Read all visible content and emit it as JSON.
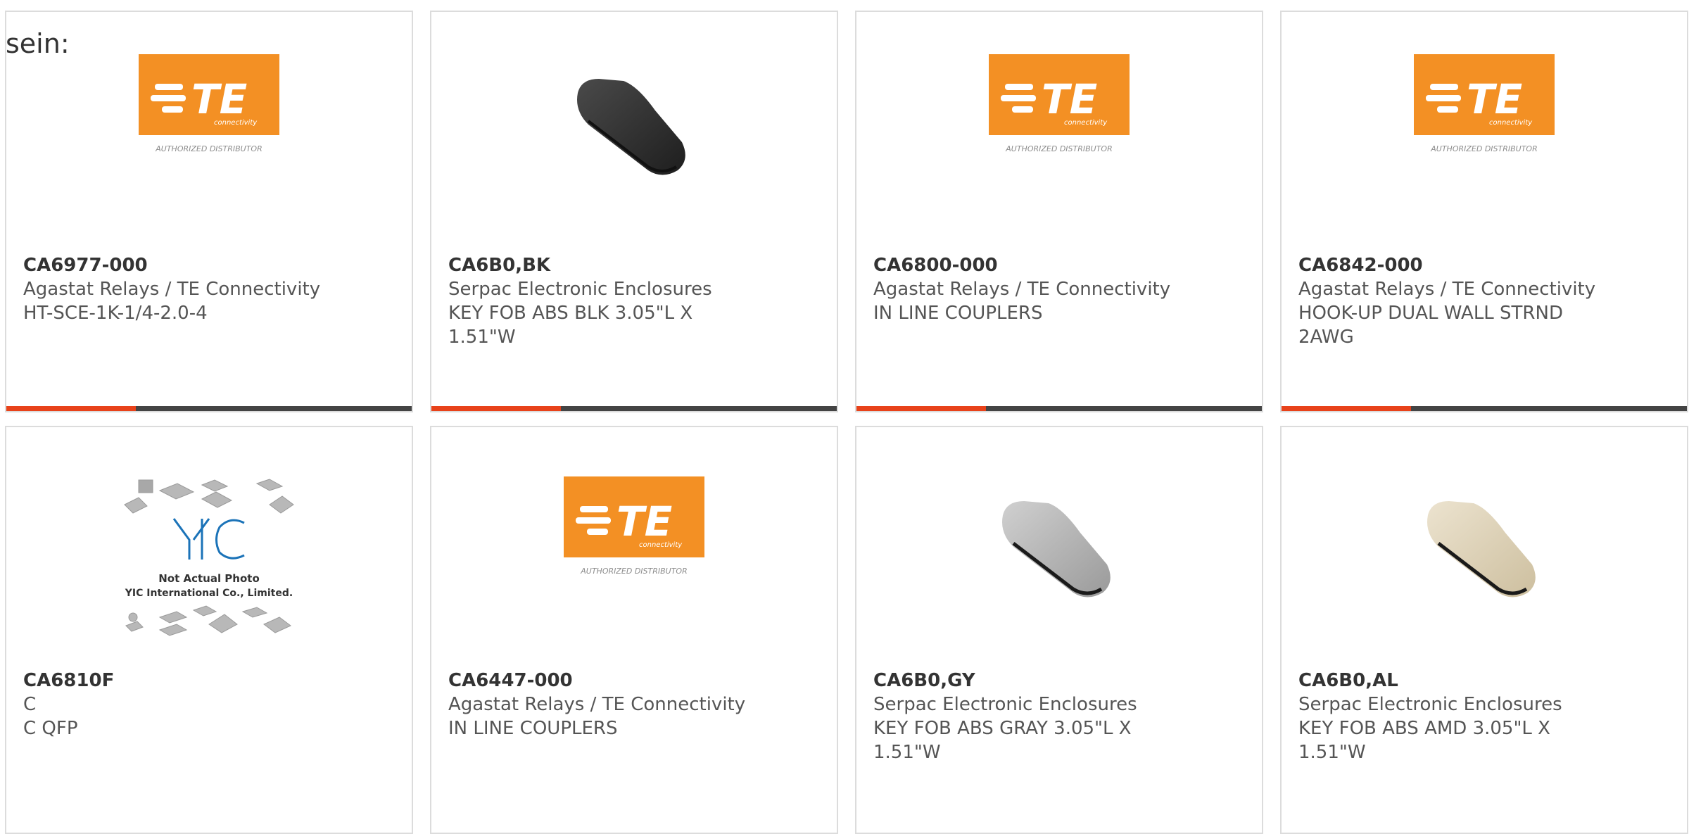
{
  "intro_text": "sein:",
  "colors": {
    "accent": "#e8421a",
    "bar": "#444444",
    "te_orange": "#f39024"
  },
  "products": [
    {
      "part": "CA6977-000",
      "maker": "Agastat Relays / TE Connectivity",
      "desc": "HT-SCE-1K-1/4-2.0-4",
      "image": "te-logo"
    },
    {
      "part": "CA6B0,BK",
      "maker": "Serpac Electronic Enclosures",
      "desc": "KEY FOB ABS BLK 3.05\"L X 1.51\"W",
      "image": "key-fob-black"
    },
    {
      "part": "CA6800-000",
      "maker": "Agastat Relays / TE Connectivity",
      "desc": "IN LINE COUPLERS",
      "image": "te-logo"
    },
    {
      "part": "CA6842-000",
      "maker": "Agastat Relays / TE Connectivity",
      "desc": "HOOK-UP DUAL WALL STRND 2AWG",
      "image": "te-logo"
    },
    {
      "part": "CA6810F",
      "maker": "C",
      "desc": "C QFP",
      "image": "yic-placeholder"
    },
    {
      "part": "CA6447-000",
      "maker": "Agastat Relays / TE Connectivity",
      "desc": "IN LINE COUPLERS",
      "image": "te-logo"
    },
    {
      "part": "CA6B0,GY",
      "maker": "Serpac Electronic Enclosures",
      "desc": "KEY FOB ABS GRAY 3.05\"L X 1.51\"W",
      "image": "key-fob-gray"
    },
    {
      "part": "CA6B0,AL",
      "maker": "Serpac Electronic Enclosures",
      "desc": "KEY FOB ABS AMD 3.05\"L X 1.51\"W",
      "image": "key-fob-almond"
    }
  ],
  "te_logo": {
    "wordmark": "TE",
    "tagline": "connectivity",
    "caption": "AUTHORIZED DISTRIBUTOR"
  },
  "yic_logo": {
    "mark": "YIC",
    "line1": "Not Actual Photo",
    "line2": "YIC International Co., Limited."
  }
}
